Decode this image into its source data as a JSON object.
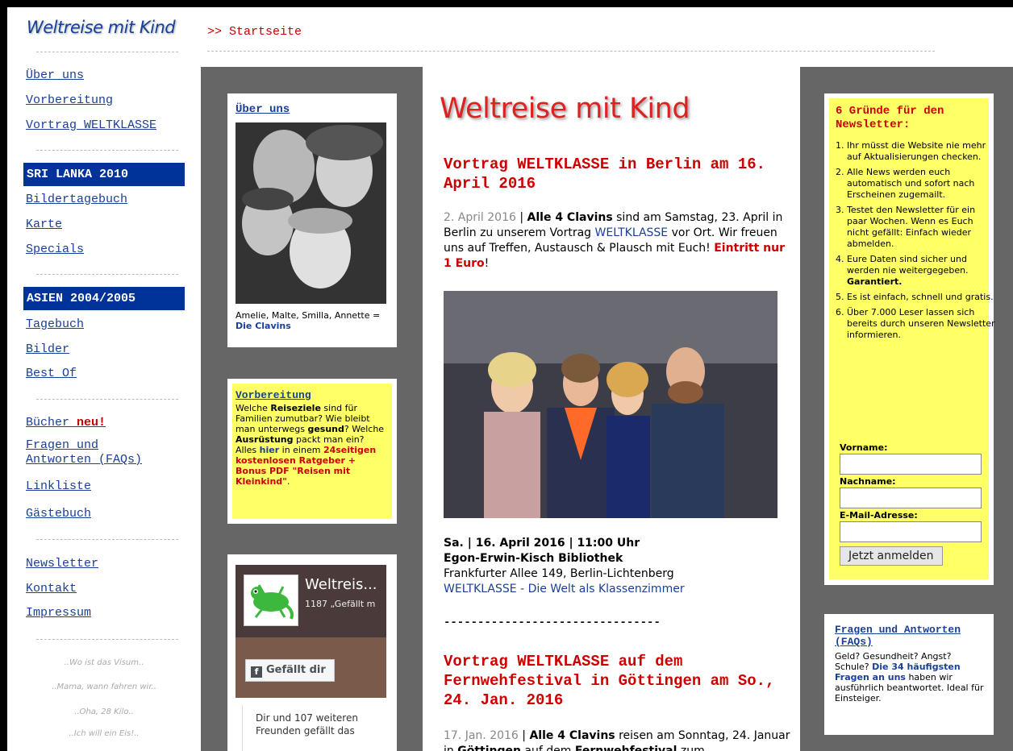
{
  "header": {
    "logo": "Weltreise mit Kind",
    "breadcrumb": ">> Startseite"
  },
  "nav": {
    "items1": [
      "Über uns",
      "Vorbereitung",
      "Vortrag WELTKLASSE"
    ],
    "section1_title": "SRI LANKA 2010",
    "items2": [
      "Bildertagebuch",
      "Karte",
      "Specials"
    ],
    "section2_title": "ASIEN 2004/2005",
    "items3": [
      "Tagebuch",
      "Bilder",
      "Best Of"
    ],
    "buecher": "Bücher",
    "neu": "neu!",
    "faq_line1": "Fragen und",
    "faq_line2": "Antworten (FAQs)",
    "linkliste": "Linkliste",
    "gaestebuch": "Gästebuch",
    "items5": [
      "Newsletter",
      "Kontakt",
      "Impressum"
    ],
    "quotes": [
      "..Wo ist das Visum..",
      "..Mama, wann fahren wir..",
      "..Oha, 28 Kilo..",
      "..Ich will ein Eis!.."
    ]
  },
  "left_col": {
    "about": {
      "title": "Über uns",
      "caption": "Amelie, Malte, Smilla, Annette =",
      "caption_link": "Die Clavins"
    },
    "prep": {
      "title": "Vorbereitung",
      "t1": "Welche ",
      "b1": "Reiseziele",
      "t2": " sind für Familien zumutbar? Wie bleibt man unterwegs ",
      "b2": "gesund",
      "t3": "? Welche ",
      "b3": "Ausrüstung",
      "t4": " packt man ein? Alles ",
      "link": "hier",
      "t5": " in einem ",
      "red": "24seitigen kostenlosen Ratgeber + Bonus PDF \"Reisen mit Kleinkind\"",
      "t6": "."
    },
    "fb": {
      "name": "Weltreis...",
      "likes": "1187 „Gefällt m",
      "like_btn": "Gefällt dir",
      "friends": "Dir und 107 weiteren Freunden gefällt das"
    }
  },
  "main": {
    "title": "Weltreise mit Kind",
    "post1": {
      "headline": "Vortrag WELTKLASSE in Berlin am 16. April 2016",
      "date": "2. April 2016",
      "sep": " | ",
      "bold": "Alle 4 Clavins",
      "t1": " sind am Samstag, 23. April in Berlin zu unserem Vortrag ",
      "link": "WELTKLASSE",
      "t2": " vor Ort. Wir freuen uns auf Treffen, Austausch & Plausch mit Euch! ",
      "red": "Eintritt nur 1 Euro",
      "t3": "!",
      "event_time": "Sa. | 16. April 2016 | 11:00 Uhr",
      "venue": "Egon-Erwin-Kisch Bibliothek",
      "address": "Frankfurter Allee 149, Berlin-Lichtenberg",
      "event_link": "WELTKLASSE - Die Welt als Klassenzimmer"
    },
    "divider": "--------------------------------",
    "post2": {
      "headline": "Vortrag WELTKLASSE auf dem Fernwehfestival in Göttingen am So., 24. Jan. 2016",
      "date": "17. Jan. 2016",
      "sep": " | ",
      "bold": "Alle 4 Clavins",
      "t1": " reisen am Sonntag, 24. Januar in ",
      "b2": "Göttingen",
      "t2": " auf dem ",
      "b3": "Fernwehfestival",
      "t3": " zum"
    }
  },
  "right_col": {
    "newsletter": {
      "title": "6 Gründe für den Newsletter:",
      "reasons": [
        "Ihr müsst die Website nie mehr auf Aktualisierungen checken.",
        "Alle News werden euch automatisch und sofort nach Erscheinen zugemailt.",
        "Testet den Newsletter für ein paar Wochen. Wenn es Euch nicht gefällt: Einfach wieder abmelden.",
        "Eure Daten sind sicher und werden nie weitergegeben.",
        "Es ist einfach, schnell und gratis.",
        "Über 7.000 Leser lassen sich bereits durch unseren Newsletter informieren."
      ],
      "garantiert": "Garantiert.",
      "label_vorname": "Vorname:",
      "label_nachname": "Nachname:",
      "label_email": "E-Mail-Adresse:",
      "button": "Jetzt anmelden"
    },
    "faq": {
      "title": "Fragen und Antworten (FAQs)",
      "t1": "Geld? Gesundheit? Angst? Schule? ",
      "link": "Die 34 häufigsten Fragen an uns",
      "t2": " haben wir ausführlich beantwortet. Ideal für Einsteiger."
    }
  },
  "colors": {
    "nav_blue": "#003399",
    "link_blue": "#1a3f96",
    "red": "#cc0000",
    "yellow": "#ffff66",
    "panel_gray": "#666666"
  }
}
